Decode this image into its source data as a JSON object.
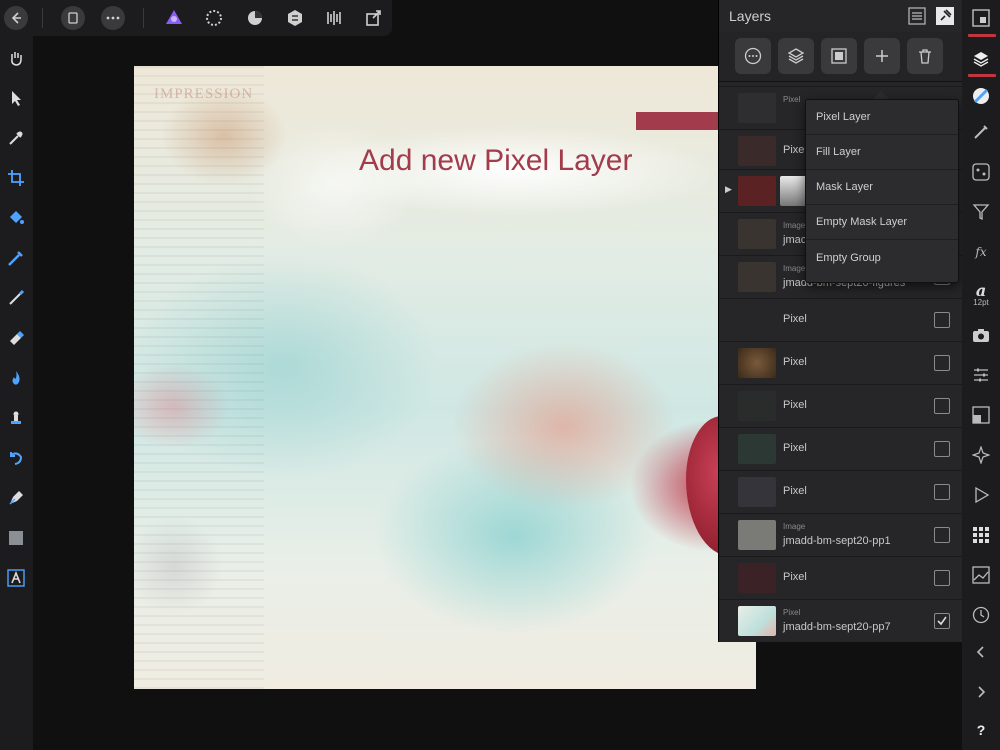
{
  "layers_panel": {
    "title": "Layers",
    "rows": [
      {
        "type": "Pixel",
        "name": "",
        "checked": false
      },
      {
        "type": "",
        "name": "Pixel",
        "checked": false
      },
      {
        "type": "",
        "name": "",
        "checked": false
      },
      {
        "type": "Image",
        "name": "jmac",
        "checked": false
      },
      {
        "type": "Image",
        "name": "jmadd-bm-sept20-figures",
        "checked": false
      },
      {
        "type": "",
        "name": "Pixel",
        "checked": false
      },
      {
        "type": "",
        "name": "Pixel",
        "checked": false
      },
      {
        "type": "",
        "name": "Pixel",
        "checked": false
      },
      {
        "type": "",
        "name": "Pixel",
        "checked": false
      },
      {
        "type": "",
        "name": "Pixel",
        "checked": false
      },
      {
        "type": "Image",
        "name": "jmadd-bm-sept20-pp1",
        "checked": false
      },
      {
        "type": "",
        "name": "Pixel",
        "checked": false
      },
      {
        "type": "Pixel",
        "name": "jmadd-bm-sept20-pp7",
        "checked": true
      }
    ]
  },
  "add_menu": {
    "items": [
      "Pixel Layer",
      "Fill Layer",
      "Mask Layer",
      "Empty Mask Layer",
      "Empty Group"
    ]
  },
  "annotation": {
    "text": "Add new Pixel Layer",
    "color": "#a23b4b"
  },
  "right_bar": {
    "text_tool_glyph": "a",
    "text_tool_size": "12pt",
    "help_label": "?"
  },
  "colors": {
    "accent": "#c0363e",
    "panel": "#262628",
    "toolbar": "#1c1c1e",
    "persona_active": "#8a5cf6"
  }
}
